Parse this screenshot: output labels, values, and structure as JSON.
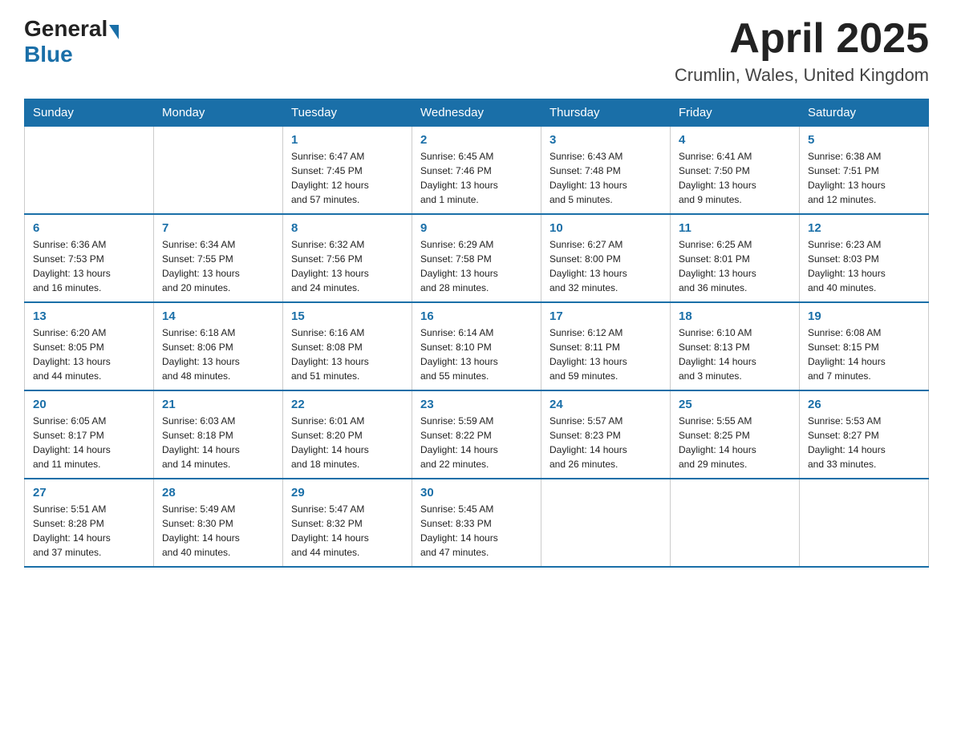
{
  "logo": {
    "general": "General",
    "blue": "Blue"
  },
  "title": "April 2025",
  "subtitle": "Crumlin, Wales, United Kingdom",
  "days_of_week": [
    "Sunday",
    "Monday",
    "Tuesday",
    "Wednesday",
    "Thursday",
    "Friday",
    "Saturday"
  ],
  "weeks": [
    [
      {
        "day": "",
        "info": ""
      },
      {
        "day": "",
        "info": ""
      },
      {
        "day": "1",
        "info": "Sunrise: 6:47 AM\nSunset: 7:45 PM\nDaylight: 12 hours\nand 57 minutes."
      },
      {
        "day": "2",
        "info": "Sunrise: 6:45 AM\nSunset: 7:46 PM\nDaylight: 13 hours\nand 1 minute."
      },
      {
        "day": "3",
        "info": "Sunrise: 6:43 AM\nSunset: 7:48 PM\nDaylight: 13 hours\nand 5 minutes."
      },
      {
        "day": "4",
        "info": "Sunrise: 6:41 AM\nSunset: 7:50 PM\nDaylight: 13 hours\nand 9 minutes."
      },
      {
        "day": "5",
        "info": "Sunrise: 6:38 AM\nSunset: 7:51 PM\nDaylight: 13 hours\nand 12 minutes."
      }
    ],
    [
      {
        "day": "6",
        "info": "Sunrise: 6:36 AM\nSunset: 7:53 PM\nDaylight: 13 hours\nand 16 minutes."
      },
      {
        "day": "7",
        "info": "Sunrise: 6:34 AM\nSunset: 7:55 PM\nDaylight: 13 hours\nand 20 minutes."
      },
      {
        "day": "8",
        "info": "Sunrise: 6:32 AM\nSunset: 7:56 PM\nDaylight: 13 hours\nand 24 minutes."
      },
      {
        "day": "9",
        "info": "Sunrise: 6:29 AM\nSunset: 7:58 PM\nDaylight: 13 hours\nand 28 minutes."
      },
      {
        "day": "10",
        "info": "Sunrise: 6:27 AM\nSunset: 8:00 PM\nDaylight: 13 hours\nand 32 minutes."
      },
      {
        "day": "11",
        "info": "Sunrise: 6:25 AM\nSunset: 8:01 PM\nDaylight: 13 hours\nand 36 minutes."
      },
      {
        "day": "12",
        "info": "Sunrise: 6:23 AM\nSunset: 8:03 PM\nDaylight: 13 hours\nand 40 minutes."
      }
    ],
    [
      {
        "day": "13",
        "info": "Sunrise: 6:20 AM\nSunset: 8:05 PM\nDaylight: 13 hours\nand 44 minutes."
      },
      {
        "day": "14",
        "info": "Sunrise: 6:18 AM\nSunset: 8:06 PM\nDaylight: 13 hours\nand 48 minutes."
      },
      {
        "day": "15",
        "info": "Sunrise: 6:16 AM\nSunset: 8:08 PM\nDaylight: 13 hours\nand 51 minutes."
      },
      {
        "day": "16",
        "info": "Sunrise: 6:14 AM\nSunset: 8:10 PM\nDaylight: 13 hours\nand 55 minutes."
      },
      {
        "day": "17",
        "info": "Sunrise: 6:12 AM\nSunset: 8:11 PM\nDaylight: 13 hours\nand 59 minutes."
      },
      {
        "day": "18",
        "info": "Sunrise: 6:10 AM\nSunset: 8:13 PM\nDaylight: 14 hours\nand 3 minutes."
      },
      {
        "day": "19",
        "info": "Sunrise: 6:08 AM\nSunset: 8:15 PM\nDaylight: 14 hours\nand 7 minutes."
      }
    ],
    [
      {
        "day": "20",
        "info": "Sunrise: 6:05 AM\nSunset: 8:17 PM\nDaylight: 14 hours\nand 11 minutes."
      },
      {
        "day": "21",
        "info": "Sunrise: 6:03 AM\nSunset: 8:18 PM\nDaylight: 14 hours\nand 14 minutes."
      },
      {
        "day": "22",
        "info": "Sunrise: 6:01 AM\nSunset: 8:20 PM\nDaylight: 14 hours\nand 18 minutes."
      },
      {
        "day": "23",
        "info": "Sunrise: 5:59 AM\nSunset: 8:22 PM\nDaylight: 14 hours\nand 22 minutes."
      },
      {
        "day": "24",
        "info": "Sunrise: 5:57 AM\nSunset: 8:23 PM\nDaylight: 14 hours\nand 26 minutes."
      },
      {
        "day": "25",
        "info": "Sunrise: 5:55 AM\nSunset: 8:25 PM\nDaylight: 14 hours\nand 29 minutes."
      },
      {
        "day": "26",
        "info": "Sunrise: 5:53 AM\nSunset: 8:27 PM\nDaylight: 14 hours\nand 33 minutes."
      }
    ],
    [
      {
        "day": "27",
        "info": "Sunrise: 5:51 AM\nSunset: 8:28 PM\nDaylight: 14 hours\nand 37 minutes."
      },
      {
        "day": "28",
        "info": "Sunrise: 5:49 AM\nSunset: 8:30 PM\nDaylight: 14 hours\nand 40 minutes."
      },
      {
        "day": "29",
        "info": "Sunrise: 5:47 AM\nSunset: 8:32 PM\nDaylight: 14 hours\nand 44 minutes."
      },
      {
        "day": "30",
        "info": "Sunrise: 5:45 AM\nSunset: 8:33 PM\nDaylight: 14 hours\nand 47 minutes."
      },
      {
        "day": "",
        "info": ""
      },
      {
        "day": "",
        "info": ""
      },
      {
        "day": "",
        "info": ""
      }
    ]
  ]
}
